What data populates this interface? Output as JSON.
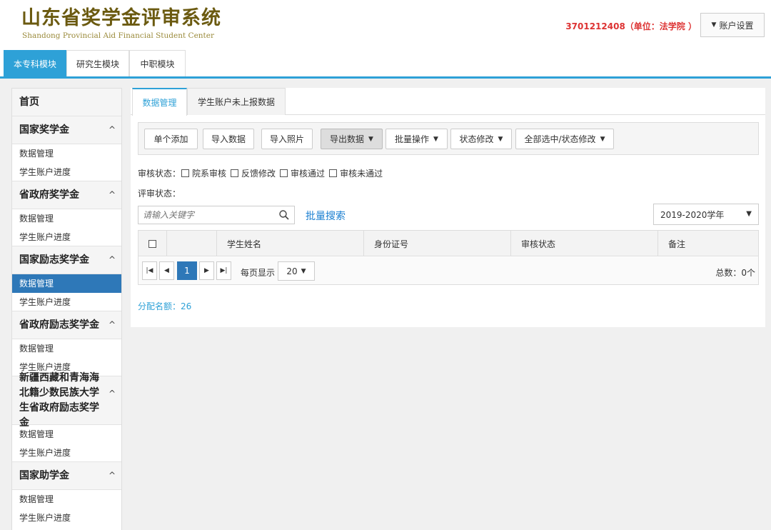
{
  "header": {
    "title": "山东省奖学金评审系统",
    "subtitle": "Shandong Provincial Aid Financial Student Center",
    "user_info": "3701212408（单位：法学院 ）",
    "account_settings": "账户设置"
  },
  "modules": [
    "本专科模块",
    "研究生模块",
    "中职模块"
  ],
  "sidebar": {
    "home": "首页",
    "sections": [
      {
        "title": "国家奖学金",
        "items": [
          "数据管理",
          "学生账户进度"
        ]
      },
      {
        "title": "省政府奖学金",
        "items": [
          "数据管理",
          "学生账户进度"
        ]
      },
      {
        "title": "国家励志奖学金",
        "items": [
          "数据管理",
          "学生账户进度"
        ]
      },
      {
        "title": "省政府励志奖学金",
        "items": [
          "数据管理",
          "学生账户进度"
        ]
      },
      {
        "title": "新疆西藏和青海海北籍少数民族大学生省政府励志奖学金",
        "items": [
          "数据管理",
          "学生账户进度"
        ]
      },
      {
        "title": "国家助学金",
        "items": [
          "数据管理",
          "学生账户进度"
        ]
      }
    ]
  },
  "subtabs": [
    "数据管理",
    "学生账户未上报数据"
  ],
  "toolbar": {
    "add_single": "单个添加",
    "import_data": "导入数据",
    "import_photo": "导入照片",
    "export_data": "导出数据",
    "batch_ops": "批量操作",
    "status_modify": "状态修改",
    "select_all_modify": "全部选中/状态修改"
  },
  "filters": {
    "audit_label": "审核状态：",
    "audit_options": [
      "院系审核",
      "反馈修改",
      "审核通过",
      "审核未通过"
    ],
    "review_label": "评审状态："
  },
  "search": {
    "placeholder": "请输入关键字",
    "batch_search": "批量搜索",
    "year": "2019-2020学年"
  },
  "table": {
    "columns": [
      "学生姓名",
      "身份证号",
      "审核状态",
      "备注"
    ]
  },
  "pager": {
    "current_page": "1",
    "per_page_label": "每页显示",
    "per_page": "20",
    "total": "总数：0个"
  },
  "quota": "分配名额：26",
  "colors": {
    "accent": "#2ea1d7",
    "active_item": "#2e78b8",
    "logo": "#6b5a10",
    "user": "#dd3333"
  }
}
